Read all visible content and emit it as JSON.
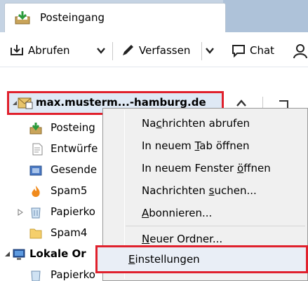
{
  "tab": {
    "label": "Posteingang"
  },
  "toolbar": {
    "get_label": "Abrufen",
    "write_label": "Verfassen",
    "chat_label": "Chat"
  },
  "account": {
    "label": "max.musterm...-hamburg.de"
  },
  "folders": [
    {
      "label": "Posteing"
    },
    {
      "label": "Entwürfe"
    },
    {
      "label": "Gesende"
    },
    {
      "label": "Spam5"
    },
    {
      "label": "Papierko"
    },
    {
      "label": "Spam4"
    },
    {
      "label": "Lokale Or"
    },
    {
      "label": "Papierko"
    }
  ],
  "context_menu": {
    "items": [
      {
        "pre": "Na",
        "key": "c",
        "post": "hrichten abrufen"
      },
      {
        "pre": "In neuem ",
        "key": "T",
        "post": "ab öffnen"
      },
      {
        "pre": "In neuem Fenster ",
        "key": "ö",
        "post": "ffnen"
      },
      {
        "pre": "Nachrichten ",
        "key": "s",
        "post": "uchen..."
      },
      {
        "pre": "",
        "key": "A",
        "post": "bonnieren..."
      },
      {
        "pre": "",
        "key": "N",
        "post": "euer Ordner..."
      },
      {
        "pre": "",
        "key": "E",
        "post": "instellungen"
      }
    ]
  },
  "colors": {
    "highlight_border": "#e0202c",
    "tabbar": "#c5d3e3",
    "menu_bg": "#f0f0f0"
  }
}
